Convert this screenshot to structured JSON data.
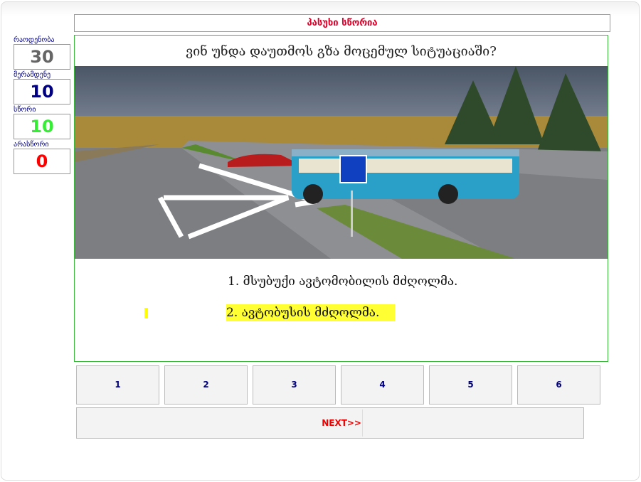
{
  "status_message": "პასუხი სწორია",
  "stats": [
    {
      "label": "რაოდენობა",
      "value": "30",
      "color": "#666666"
    },
    {
      "label": "მერამდენე",
      "value": "10",
      "color": "#000080"
    },
    {
      "label": "სწორი",
      "value": "10",
      "color": "#33ee33"
    },
    {
      "label": "არასწორი",
      "value": "0",
      "color": "#ff0000"
    }
  ],
  "question": "ვინ უნდა დაუთმოს გზა მოცემულ სიტუაციაში?",
  "answers": [
    "1. მსუბუქი ავტომობილის მძღოლმა.",
    "2. ავტობუსის მძღოლმა."
  ],
  "answer_buttons": [
    "1",
    "2",
    "3",
    "4",
    "5",
    "6"
  ],
  "next_label": "NEXT>>"
}
